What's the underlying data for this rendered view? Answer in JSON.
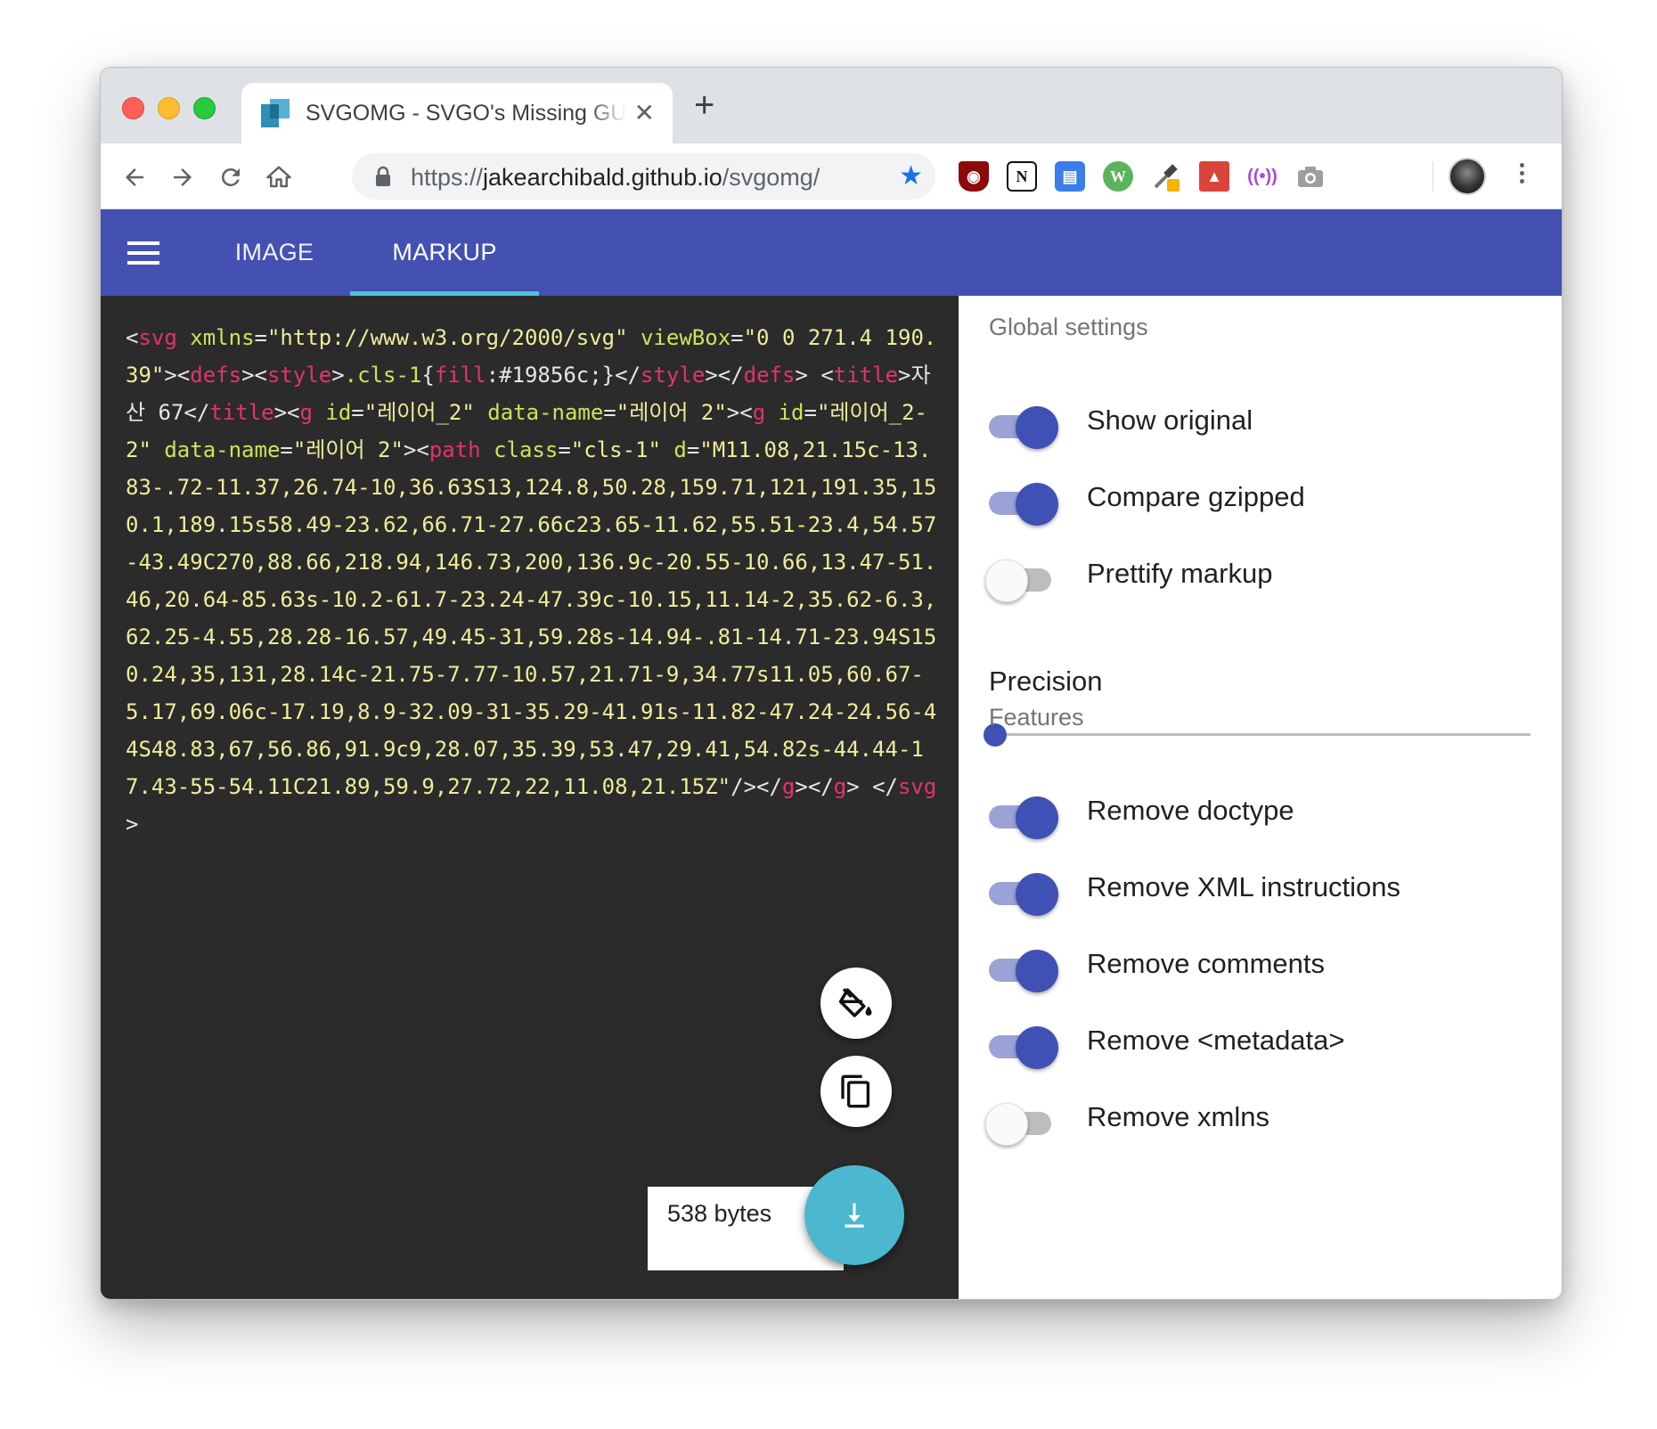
{
  "browser": {
    "tab_title": "SVGOMG - SVGO's Missing GUI",
    "url_scheme": "https://",
    "url_host": "jakearchibald.github.io",
    "url_path": "/svgomg/"
  },
  "appbar": {
    "tabs": [
      {
        "label": "IMAGE",
        "active": false
      },
      {
        "label": "MARKUP",
        "active": true
      }
    ],
    "accent_color": "#4451b2",
    "indicator_color": "#4fc3d6"
  },
  "code": {
    "lines": [
      [
        [
          "p",
          "<"
        ],
        [
          "tag",
          "svg"
        ],
        [
          "p",
          " "
        ],
        [
          "attr",
          "xmlns"
        ],
        [
          "p",
          "="
        ],
        [
          "str",
          "\"http://www.w3.org/2000/svg\""
        ],
        [
          "p",
          " "
        ],
        [
          "attr",
          "viewBox"
        ],
        [
          "p",
          "="
        ],
        [
          "str",
          "\"0 0 271.4 190.39\""
        ],
        [
          "p",
          "><"
        ],
        [
          "tag",
          "defs"
        ],
        [
          "p",
          "><"
        ],
        [
          "tag",
          "style"
        ],
        [
          "p",
          ">"
        ],
        [
          "attr",
          ".cls-1"
        ],
        [
          "p",
          "{"
        ],
        [
          "tag",
          "fill"
        ],
        [
          "p",
          ":#19856c;}</"
        ],
        [
          "tag",
          "style"
        ],
        [
          "p",
          "></"
        ],
        [
          "tag",
          "defs"
        ],
        [
          "p",
          "> <"
        ],
        [
          "tag",
          "title"
        ],
        [
          "p",
          ">자산 67</"
        ],
        [
          "tag",
          "title"
        ],
        [
          "p",
          "><"
        ],
        [
          "tag",
          "g"
        ],
        [
          "p",
          " "
        ],
        [
          "attr",
          "id"
        ],
        [
          "p",
          "="
        ],
        [
          "str",
          "\"레이어_2\""
        ],
        [
          "p",
          " "
        ],
        [
          "attr",
          "data-name"
        ],
        [
          "p",
          "="
        ],
        [
          "str",
          "\"레이어 2\""
        ],
        [
          "p",
          "><"
        ],
        [
          "tag",
          "g"
        ],
        [
          "p",
          " "
        ],
        [
          "attr",
          "id"
        ],
        [
          "p",
          "="
        ],
        [
          "str",
          "\"레이어_2-2\""
        ],
        [
          "p",
          " "
        ],
        [
          "attr",
          "data-name"
        ],
        [
          "p",
          "="
        ],
        [
          "str",
          "\"레이어 2\""
        ],
        [
          "p",
          "><"
        ],
        [
          "tag",
          "path"
        ],
        [
          "p",
          " "
        ],
        [
          "attr",
          "class"
        ],
        [
          "p",
          "="
        ],
        [
          "str",
          "\"cls-1\""
        ],
        [
          "p",
          " "
        ],
        [
          "attr",
          "d"
        ],
        [
          "p",
          "="
        ],
        [
          "str",
          "\"M11.08,21.15c-13.83-.72-11.37,26.74-10,36.63S13,124.8,50.28,159.71,121,191.35,150.1,189.15s58.49-23.62,66.71-27.66c23.65-11.62,55.51-23.4,54.57-43.49C270,88.66,218.94,146.73,200,136.9c-20.55-10.66,13.47-51.46,20.64-85.63s-10.2-61.7-23.24-47.39c-10.15,11.14-2,35.62-6.3,62.25-4.55,28.28-16.57,49.45-31,59.28s-14.94-.81-14.71-23.94S150.24,35,131,28.14c-21.75-7.77-10.57,21.71-9,34.77s11.05,60.67-5.17,69.06c-17.19,8.9-32.09-31-35.29-41.91s-11.82-47.24-24.56-44S48.83,67,56.86,91.9c9,28.07,35.39,53.47,29.41,54.82s-44.44-17.43-55-54.11C21.89,59.9,27.72,22,11.08,21.15Z\""
        ],
        [
          "p",
          "/></"
        ],
        [
          "tag",
          "g"
        ],
        [
          "p",
          "></"
        ],
        [
          "tag",
          "g"
        ],
        [
          "p",
          "> </"
        ],
        [
          "tag",
          "svg"
        ],
        [
          "p",
          ">"
        ]
      ]
    ]
  },
  "output": {
    "size": "538 bytes"
  },
  "settings": {
    "global_heading": "Global settings",
    "global": [
      {
        "label": "Show original",
        "on": true
      },
      {
        "label": "Compare gzipped",
        "on": true
      },
      {
        "label": "Prettify markup",
        "on": false
      }
    ],
    "precision_label": "Precision",
    "precision_value": 0,
    "features_heading": "Features",
    "features": [
      {
        "label": "Remove doctype",
        "on": true
      },
      {
        "label": "Remove XML instructions",
        "on": true
      },
      {
        "label": "Remove comments",
        "on": true
      },
      {
        "label": "Remove <metadata>",
        "on": true
      },
      {
        "label": "Remove xmlns",
        "on": false
      }
    ]
  },
  "icons": {
    "back": "arrow-left-icon",
    "forward": "arrow-right-icon",
    "reload": "reload-icon",
    "home": "home-icon",
    "lock": "lock-icon",
    "bookmark": "star-icon",
    "menu": "hamburger-icon",
    "paint": "paint-bucket-icon",
    "copy": "copy-icon",
    "download": "download-icon"
  }
}
